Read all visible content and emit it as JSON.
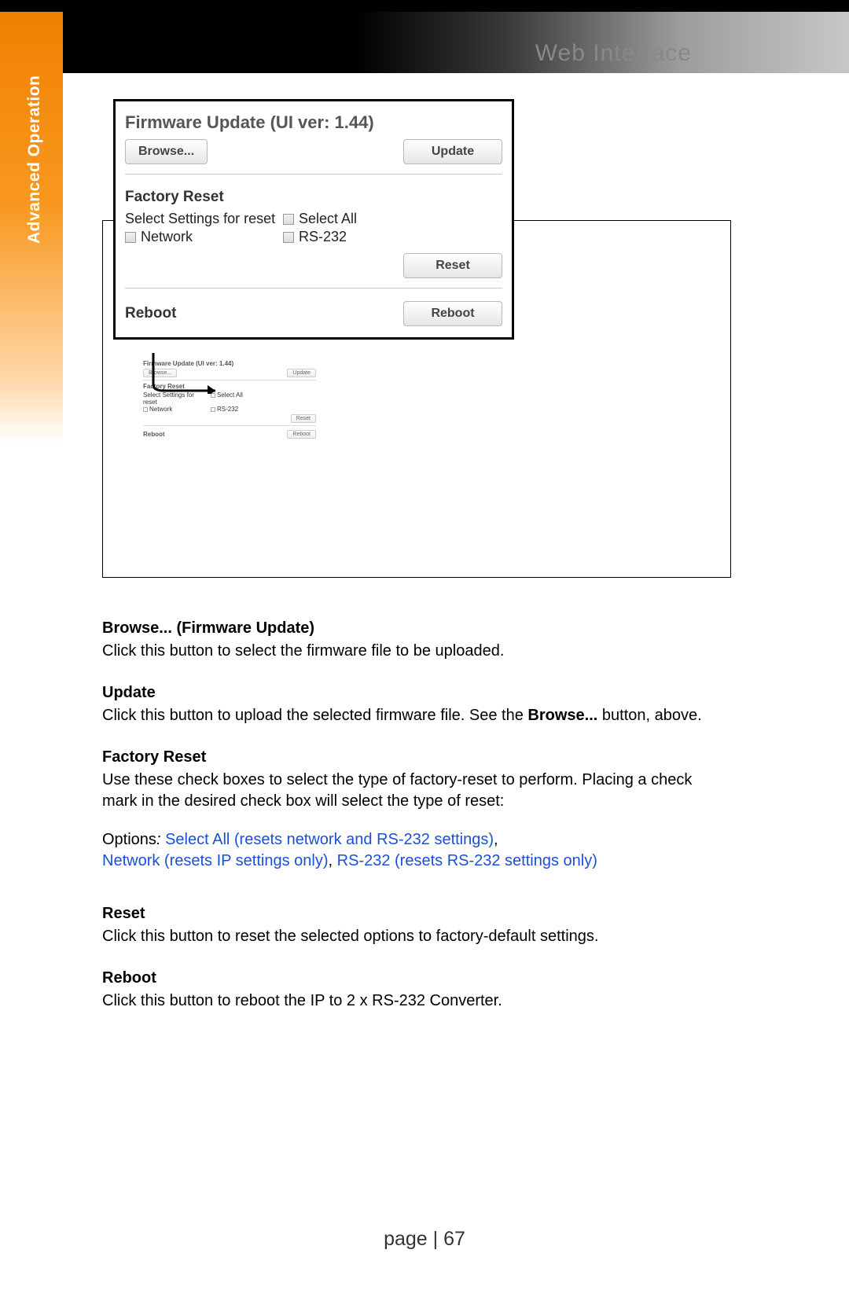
{
  "header": {
    "title": "Web Interface"
  },
  "side_tab": "Advanced Operation",
  "panel": {
    "firmware_title": "Firmware Update (UI ver: 1.44)",
    "browse_label": "Browse...",
    "update_label": "Update",
    "factory_title": "Factory Reset",
    "select_settings_label": "Select Settings for reset",
    "select_all_label": "Select All",
    "network_label": "Network",
    "rs232_label": "RS-232",
    "reset_label": "Reset",
    "reboot_title": "Reboot",
    "reboot_label": "Reboot"
  },
  "mini": {
    "firmware_title": "Firmware Update (UI ver: 1.44)",
    "browse": "Browse...",
    "update": "Update",
    "factory": "Factory Reset",
    "sel_label": "Select Settings for reset",
    "sel_all": "Select All",
    "network": "Network",
    "rs232": "RS-232",
    "reset": "Reset",
    "reboot_t": "Reboot",
    "reboot": "Reboot"
  },
  "doc": {
    "h1": "Browse... (Firmware Update)",
    "p1": "Click this button to select the firmware file to be uploaded.",
    "h2": "Update",
    "p2a": "Click this button to upload the selected firmware file.  See the ",
    "p2b": "Browse...",
    "p2c": " button, above.",
    "h3": "Factory Reset",
    "p3": "Use these check boxes to select the type of factory-reset to perform. Placing a check mark in the desired check box will select the type of reset:",
    "opt_prefix": "Options",
    "opt_colon": ": ",
    "opt1": "Select All (resets network and RS-232 settings)",
    "opt_comma": ", ",
    "opt2": "Network (resets IP settings only)",
    "opt3": "RS-232 (resets RS-232 settings only)",
    "h4": "Reset",
    "p4": "Click this button to reset the selected options to factory-default settings.",
    "h5": "Reboot",
    "p5": "Click this button to reboot the IP to 2 x RS-232 Converter."
  },
  "footer": {
    "page_label": "page | 67"
  }
}
